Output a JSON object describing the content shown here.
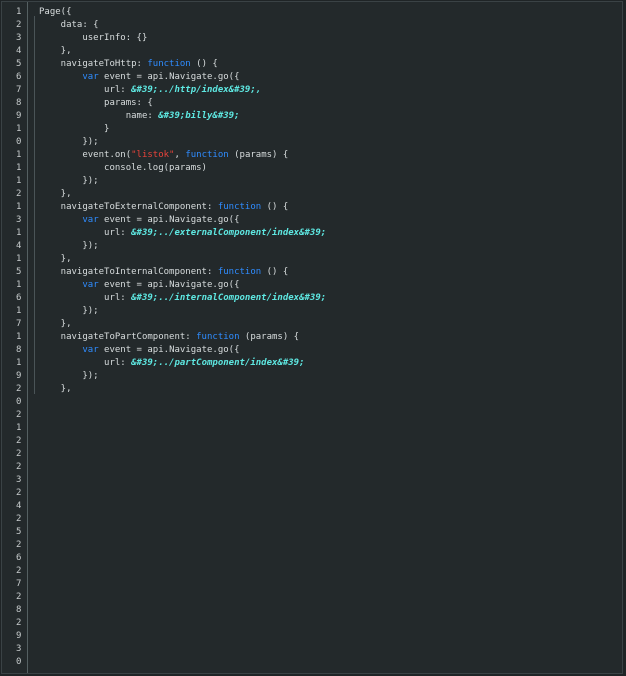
{
  "gutter": {
    "line_numbers": [
      "1",
      "2",
      "3",
      "4",
      "5",
      "6",
      "7",
      "8",
      "9",
      "1",
      "0",
      "1",
      "1",
      "1",
      "2",
      "1",
      "3",
      "1",
      "4",
      "1",
      "5",
      "1",
      "6",
      "1",
      "7",
      "1",
      "8",
      "1",
      "9",
      "2",
      "0",
      "2",
      "1",
      "2",
      "2",
      "2",
      "3",
      "2",
      "4",
      "2",
      "5",
      "2",
      "6",
      "2",
      "7",
      "2",
      "8",
      "2",
      "9",
      "3",
      "0"
    ]
  },
  "code": {
    "lines": [
      [
        {
          "t": "Page({",
          "c": ""
        }
      ],
      [
        {
          "t": "    data: {",
          "c": ""
        }
      ],
      [
        {
          "t": "        userInfo: {}",
          "c": ""
        }
      ],
      [
        {
          "t": "    },",
          "c": ""
        }
      ],
      [
        {
          "t": "    navigateToHttp: ",
          "c": ""
        },
        {
          "t": "function",
          "c": "kw"
        },
        {
          "t": " () {",
          "c": ""
        }
      ],
      [
        {
          "t": "        ",
          "c": ""
        },
        {
          "t": "var",
          "c": "kw"
        },
        {
          "t": " event = api.Navigate.go({",
          "c": ""
        }
      ],
      [
        {
          "t": "            url: ",
          "c": ""
        },
        {
          "t": "&#39;../http/index&#39;,",
          "c": "ent"
        }
      ],
      [
        {
          "t": "            params: {",
          "c": ""
        }
      ],
      [
        {
          "t": "                name: ",
          "c": ""
        },
        {
          "t": "&#39;billy&#39;",
          "c": "ent"
        }
      ],
      [
        {
          "t": "            }",
          "c": ""
        }
      ],
      [
        {
          "t": "        });",
          "c": ""
        }
      ],
      [
        {
          "t": "        event.on(",
          "c": ""
        },
        {
          "t": "\"listok\"",
          "c": "str"
        },
        {
          "t": ", ",
          "c": ""
        },
        {
          "t": "function",
          "c": "kw"
        },
        {
          "t": " (params) {",
          "c": ""
        }
      ],
      [
        {
          "t": "            console.log(params)",
          "c": ""
        }
      ],
      [
        {
          "t": "        });",
          "c": ""
        }
      ],
      [
        {
          "t": "    },",
          "c": ""
        }
      ],
      [
        {
          "t": "    navigateToExternalComponent: ",
          "c": ""
        },
        {
          "t": "function",
          "c": "kw"
        },
        {
          "t": " () {",
          "c": ""
        }
      ],
      [
        {
          "t": "        ",
          "c": ""
        },
        {
          "t": "var",
          "c": "kw"
        },
        {
          "t": " event = api.Navigate.go({",
          "c": ""
        }
      ],
      [
        {
          "t": "            url: ",
          "c": ""
        },
        {
          "t": "&#39;../externalComponent/index&#39;",
          "c": "ent"
        }
      ],
      [
        {
          "t": "        });",
          "c": ""
        }
      ],
      [
        {
          "t": "    },",
          "c": ""
        }
      ],
      [
        {
          "t": "    navigateToInternalComponent: ",
          "c": ""
        },
        {
          "t": "function",
          "c": "kw"
        },
        {
          "t": " () {",
          "c": ""
        }
      ],
      [
        {
          "t": "        ",
          "c": ""
        },
        {
          "t": "var",
          "c": "kw"
        },
        {
          "t": " event = api.Navigate.go({",
          "c": ""
        }
      ],
      [
        {
          "t": "            url: ",
          "c": ""
        },
        {
          "t": "&#39;../internalComponent/index&#39;",
          "c": "ent"
        }
      ],
      [
        {
          "t": "        });",
          "c": ""
        }
      ],
      [
        {
          "t": "    },",
          "c": ""
        }
      ],
      [
        {
          "t": "    navigateToPartComponent: ",
          "c": ""
        },
        {
          "t": "function",
          "c": "kw"
        },
        {
          "t": " (params) {",
          "c": ""
        }
      ],
      [
        {
          "t": "        ",
          "c": ""
        },
        {
          "t": "var",
          "c": "kw"
        },
        {
          "t": " event = api.Navigate.go({",
          "c": ""
        }
      ],
      [
        {
          "t": "            url: ",
          "c": ""
        },
        {
          "t": "&#39;../partComponent/index&#39;",
          "c": "ent"
        }
      ],
      [
        {
          "t": "        });",
          "c": ""
        }
      ],
      [
        {
          "t": "    },",
          "c": ""
        }
      ]
    ]
  },
  "colors": {
    "background": "#23292b",
    "keyword": "#2f8cff",
    "string": "#e8433a",
    "entity": "#5ee8e2",
    "text": "#d7dcdd"
  }
}
